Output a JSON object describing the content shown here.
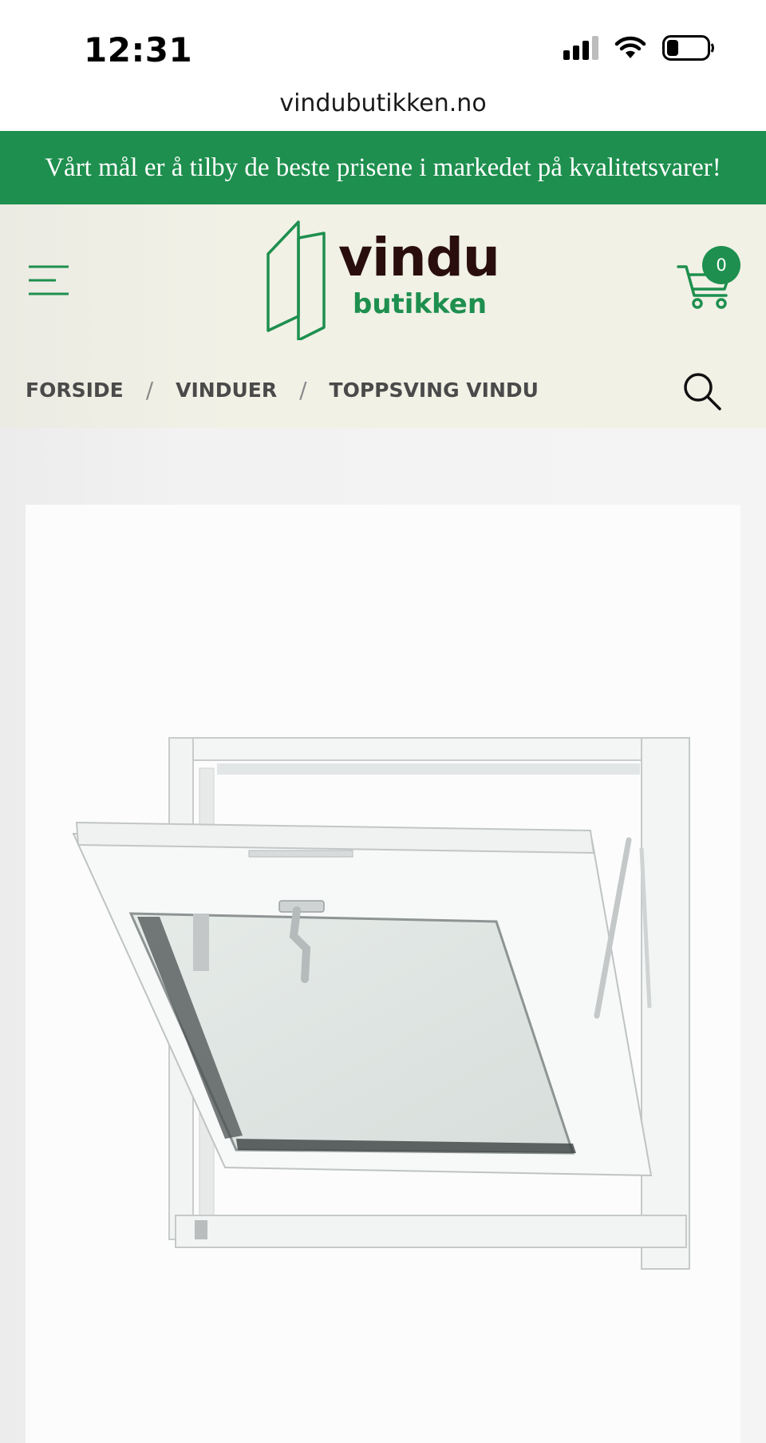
{
  "status_bar": {
    "time": "12:31"
  },
  "browser": {
    "url": "vindubutikken.no"
  },
  "promo_banner": {
    "text": "Vårt mål er å tilby de beste prisene i markedet på kvalitetsvarer!"
  },
  "header": {
    "logo_word": "vindu",
    "logo_sub": "butikken",
    "cart_count": "0"
  },
  "breadcrumb": {
    "items": [
      "FORSIDE",
      "VINDUER",
      "TOPPSVING VINDU"
    ],
    "separator": "/"
  },
  "colors": {
    "brand_green": "#1e8f4e",
    "logo_dark": "#2a0e0e",
    "header_bg": "#f1f1e6"
  },
  "icons": [
    "menu-icon",
    "cart-icon",
    "search-icon",
    "signal-icon",
    "wifi-icon",
    "battery-icon"
  ]
}
